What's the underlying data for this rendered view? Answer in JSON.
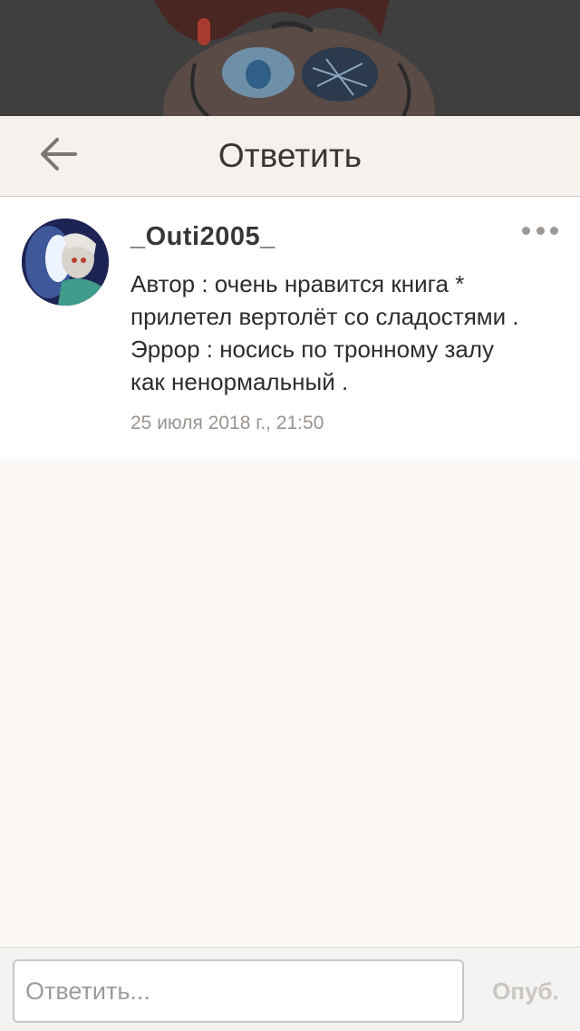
{
  "header": {
    "title": "Ответить"
  },
  "comment": {
    "username": "_Outi2005_",
    "lines": [
      "Автор : очень нравится книга *",
      "прилетел вертолёт со сладостями .",
      "Эррор : носись по тронному залу",
      "как ненормальный ."
    ],
    "timestamp": "25 июля 2018 г., 21:50"
  },
  "footer": {
    "reply_placeholder": "Ответить...",
    "publish_label": "Опуб."
  },
  "icons": {
    "back": "arrow-left-icon",
    "more": "more-dots-icon"
  },
  "colors": {
    "header_bg": "#f6f1ec",
    "page_bg": "#fbf8f5",
    "publish_disabled": "#c9c6c3"
  }
}
